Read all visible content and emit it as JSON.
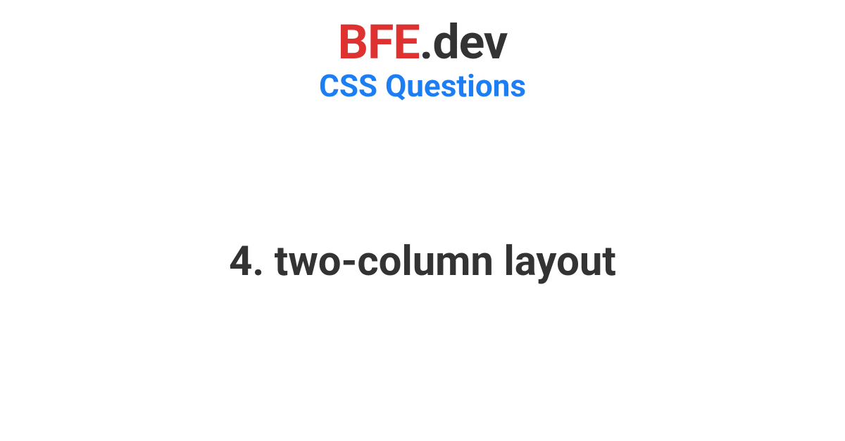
{
  "logo": {
    "brand": "BFE",
    "suffix": ".dev"
  },
  "category": "CSS Questions",
  "title": "4. two-column layout",
  "colors": {
    "brand_red": "#e03131",
    "link_blue": "#1c7ef2",
    "text_dark": "#333333"
  }
}
